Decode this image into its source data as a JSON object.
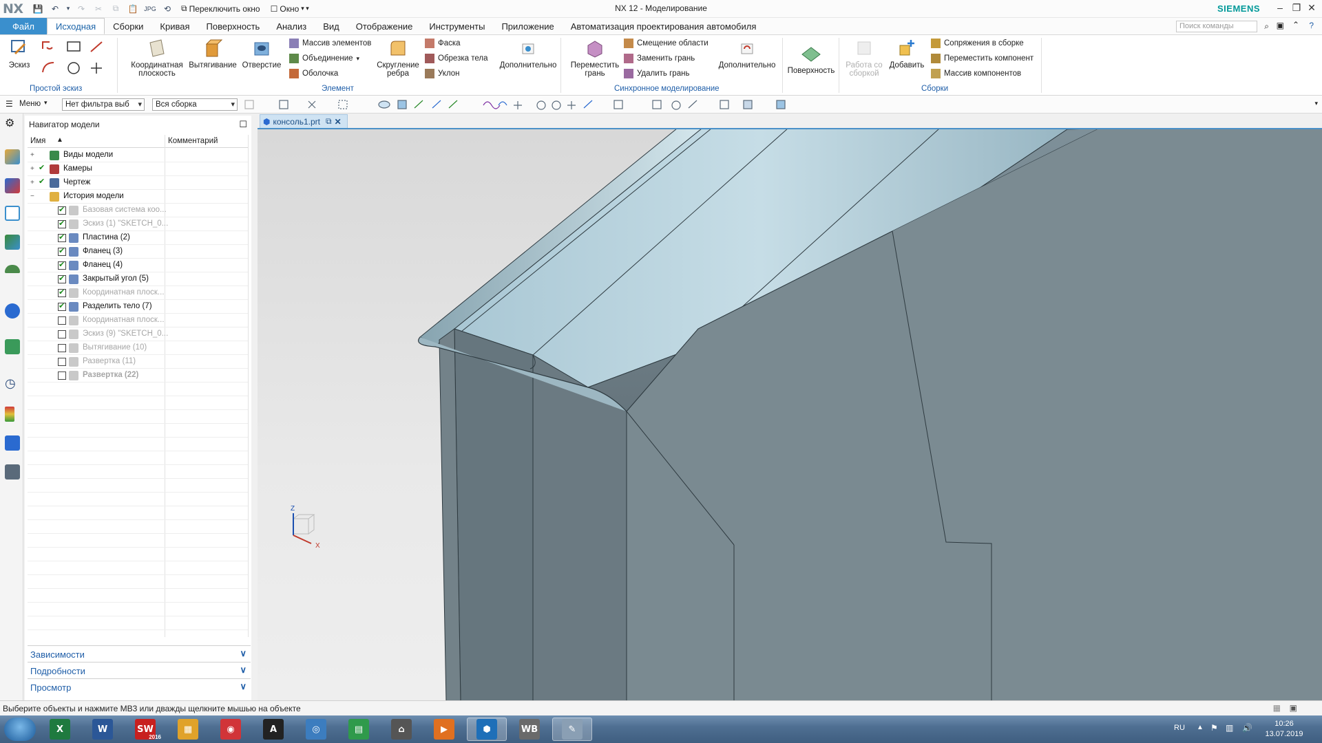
{
  "titlebar": {
    "logo": "NX",
    "switch_window": "Переключить окно",
    "window_menu": "Окно",
    "title": "NX 12 - Моделирование",
    "brand": "SIEMENS"
  },
  "tabs": [
    {
      "label": "Файл"
    },
    {
      "label": "Исходная"
    },
    {
      "label": "Сборки"
    },
    {
      "label": "Кривая"
    },
    {
      "label": "Поверхность"
    },
    {
      "label": "Анализ"
    },
    {
      "label": "Вид"
    },
    {
      "label": "Отображение"
    },
    {
      "label": "Инструменты"
    },
    {
      "label": "Приложение"
    },
    {
      "label": "Автоматизация проектирования автомобиля"
    }
  ],
  "command_search_placeholder": "Поиск команды",
  "ribbon": {
    "sketch": "Эскиз",
    "group_simple_sketch": "Простой эскиз",
    "datum_plane": "Координатная плоскость",
    "extrude": "Вытягивание",
    "hole": "Отверстие",
    "pattern_feature": "Массив элементов",
    "unite": "Объединение",
    "shell": "Оболочка",
    "edge_blend": "Скругление ребра",
    "chamfer": "Фаска",
    "trim_body": "Обрезка тела",
    "draft": "Уклон",
    "more_feature": "Дополнительно",
    "group_feature": "Элемент",
    "move_face": "Переместить грань",
    "offset_region": "Смещение области",
    "replace_face": "Заменить грань",
    "delete_face": "Удалить грань",
    "more_sync": "Дополнительно",
    "group_sync": "Синхронное моделирование",
    "surface": "Поверхность",
    "work_assembly": "Работа со сборкой",
    "add": "Добавить",
    "assembly_constraints": "Сопряжения в сборке",
    "move_component": "Переместить компонент",
    "pattern_component": "Массив компонентов",
    "group_assemblies": "Сборки"
  },
  "toolbar": {
    "menu": "Меню",
    "filter": "Нет фильтра выб",
    "scope": "Вся сборка"
  },
  "navigator": {
    "title": "Навигатор модели",
    "col_name": "Имя",
    "col_comment": "Комментарий",
    "items": [
      {
        "label": "Виды модели",
        "checked": false,
        "dim": false
      },
      {
        "label": "Камеры",
        "checked": true,
        "dim": false
      },
      {
        "label": "Чертеж",
        "checked": true,
        "dim": false
      },
      {
        "label": "История модели",
        "checked": false,
        "dim": false
      },
      {
        "label": "Базовая система коо...",
        "checked": true,
        "dim": true
      },
      {
        "label": "Эскиз (1) \"SKETCH_0...",
        "checked": true,
        "dim": true
      },
      {
        "label": "Пластина (2)",
        "checked": true,
        "dim": false
      },
      {
        "label": "Фланец (3)",
        "checked": true,
        "dim": false
      },
      {
        "label": "Фланец (4)",
        "checked": true,
        "dim": false
      },
      {
        "label": "Закрытый угол (5)",
        "checked": true,
        "dim": false
      },
      {
        "label": "Координатная плоск...",
        "checked": true,
        "dim": true
      },
      {
        "label": "Разделить тело (7)",
        "checked": true,
        "dim": false
      },
      {
        "label": "Координатная плоск...",
        "checked": false,
        "dim": true
      },
      {
        "label": "Эскиз (9) \"SKETCH_0...",
        "checked": false,
        "dim": true
      },
      {
        "label": "Вытягивание (10)",
        "checked": false,
        "dim": true
      },
      {
        "label": "Развертка (11)",
        "checked": false,
        "dim": true
      },
      {
        "label": "Развертка (22)",
        "checked": false,
        "dim": true
      }
    ],
    "sections": [
      {
        "label": "Зависимости"
      },
      {
        "label": "Подробности"
      },
      {
        "label": "Просмотр"
      }
    ]
  },
  "document_tab": "консоль1.prt",
  "viewport": {
    "triad_x": "X",
    "triad_z": "Z"
  },
  "status": "Выберите объекты и нажмите MB3 или дважды щелкните мышью на объекте",
  "taskbar": {
    "apps": [
      {
        "name": "excel",
        "glyph": "X",
        "color": "#1f7a3f"
      },
      {
        "name": "word",
        "glyph": "W",
        "color": "#2b5797"
      },
      {
        "name": "solidworks",
        "glyph": "SW",
        "color": "#c8201f",
        "caption": "2016"
      },
      {
        "name": "apps",
        "glyph": "▦",
        "color": "#e0a22a"
      },
      {
        "name": "screenshot",
        "glyph": "◉",
        "color": "#d13438"
      },
      {
        "name": "autocad",
        "glyph": "A",
        "color": "#222222"
      },
      {
        "name": "network",
        "glyph": "◎",
        "color": "#3c7dbf"
      },
      {
        "name": "sheets",
        "glyph": "▤",
        "color": "#2f9a4b"
      },
      {
        "name": "inventor",
        "glyph": "⌂",
        "color": "#555555"
      },
      {
        "name": "media",
        "glyph": "▶",
        "color": "#e07020"
      },
      {
        "name": "nx",
        "glyph": "⬢",
        "color": "#1e6fb8"
      },
      {
        "name": "workbench",
        "glyph": "WB",
        "color": "#6a6a6a"
      },
      {
        "name": "paint",
        "glyph": "✎",
        "color": "#8a9fb4"
      }
    ],
    "lang": "RU",
    "time": "10:26",
    "date": "13.07.2019"
  },
  "colors": {
    "accent": "#3a8fcd",
    "ribbon_group_label": "#1f5ea8",
    "brand": "#009999",
    "model_top": "#b9d4df",
    "model_side": "#6f7e86"
  }
}
